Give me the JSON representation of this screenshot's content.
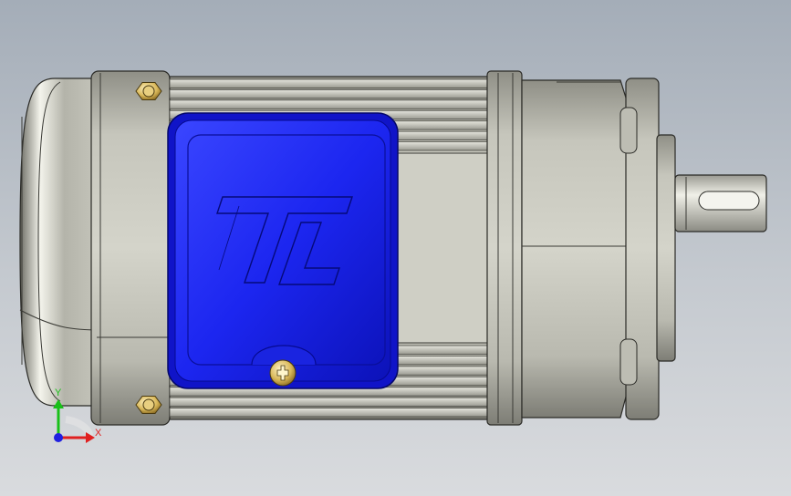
{
  "scene": {
    "background_top": "#a4adb8",
    "background_bottom": "#d9dbde",
    "body_color": "#c9c9bf",
    "terminal_box_color": "#1f2cff",
    "bolt_color": "#d9b85a",
    "logo_text": "TL"
  },
  "triad": {
    "x_label": "X",
    "y_label": "Y",
    "x_color": "#e02020",
    "y_color": "#18c018",
    "origin_color": "#2020e0"
  }
}
